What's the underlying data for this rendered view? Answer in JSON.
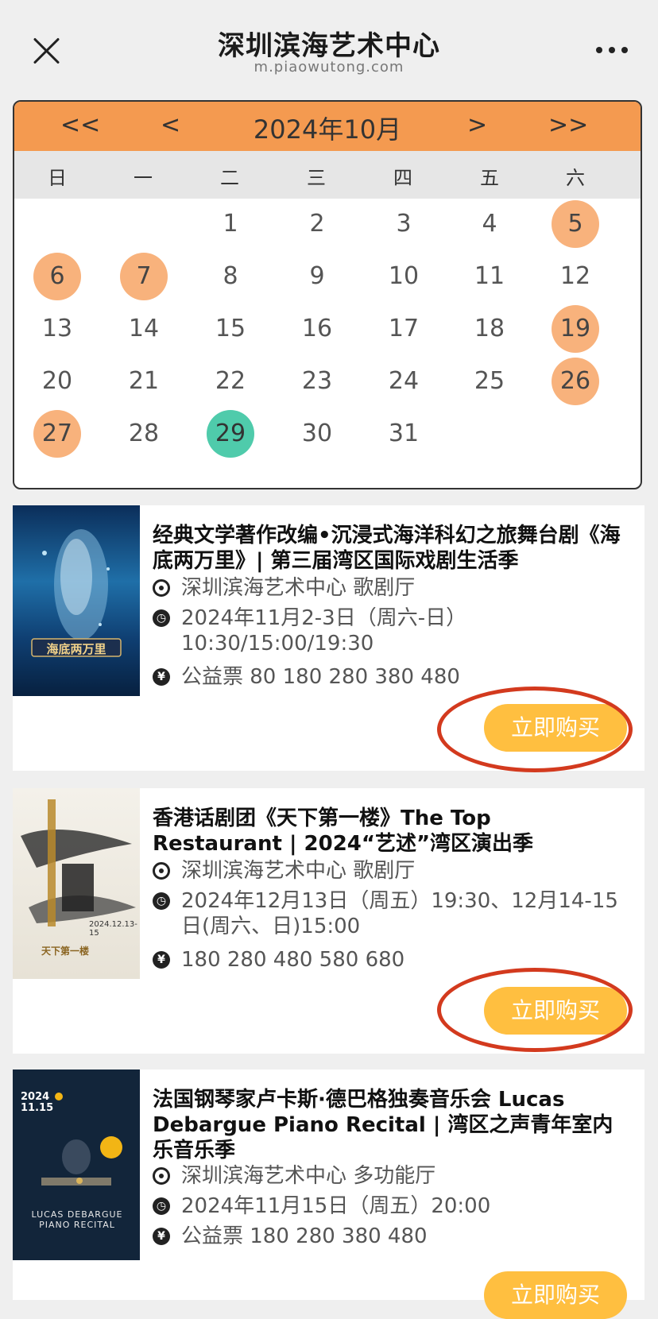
{
  "header": {
    "title": "深圳滨海艺术中心",
    "url": "m.piaowutong.com"
  },
  "calendar": {
    "nav_first": "<<",
    "nav_prev": "<",
    "month_label": "2024年10月",
    "nav_next": ">",
    "nav_last": ">>",
    "weekdays": [
      "日",
      "一",
      "二",
      "三",
      "四",
      "五",
      "六"
    ],
    "days": [
      "1",
      "2",
      "3",
      "4",
      "5",
      "6",
      "7",
      "8",
      "9",
      "10",
      "11",
      "12",
      "13",
      "14",
      "15",
      "16",
      "17",
      "18",
      "19",
      "20",
      "21",
      "22",
      "23",
      "24",
      "25",
      "26",
      "27",
      "28",
      "29",
      "30",
      "31"
    ],
    "highlight_color": "#f8b27c",
    "today_color": "#4fcbab"
  },
  "events": [
    {
      "title": "经典文学著作改编•沉浸式海洋科幻之旅舞台剧《海底两万里》| 第三届湾区国际戏剧生活季",
      "venue": "深圳滨海艺术中心 歌剧厅",
      "time": "2024年11月2-3日（周六-日）10:30/15:00/19:30",
      "price": "公益票 80 180 280 380 480",
      "buy_label": "立即购买",
      "poster_text": "海底两万里"
    },
    {
      "title": "香港话剧团《天下第一楼》The Top Restaurant | 2024“艺述”湾区演出季",
      "venue": "深圳滨海艺术中心 歌剧厅",
      "time": "2024年12月13日（周五）19:30、12月14-15日(周六、日)15:00",
      "price": "180 280 480 580 680",
      "buy_label": "立即购买",
      "poster_text": "天下第一楼",
      "poster_date": "2024.12.13-15"
    },
    {
      "title": "法国钢琴家卢卡斯·德巴格独奏音乐会 Lucas Debargue Piano Recital | 湾区之声青年室内乐音乐季",
      "venue": "深圳滨海艺术中心 多功能厅",
      "time": "2024年11月15日（周五）20:00",
      "price": "公益票 180 280 380 480",
      "buy_label": "立即购买",
      "poster_text": "LUCAS DEBARGUE PIANO RECITAL",
      "poster_date": "2024 11.15"
    }
  ],
  "icons": {
    "venue": "location-icon",
    "time": "clock-icon",
    "price": "yen-icon"
  },
  "colors": {
    "calendar_header": "#f49a50",
    "buy_button": "#ffbf40",
    "annotation_ring": "#d33a1e"
  }
}
